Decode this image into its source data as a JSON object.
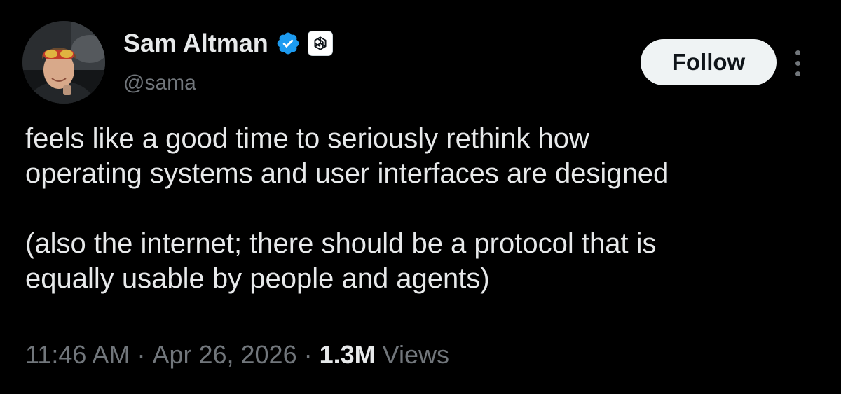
{
  "author": {
    "display_name": "Sam Altman",
    "handle": "@sama",
    "verified_icon": "verified-badge-icon",
    "affiliation_icon": "openai-logo-icon"
  },
  "actions": {
    "follow_label": "Follow",
    "more_icon": "more-vertical-icon"
  },
  "tweet": {
    "lines_paragraph_1": [
      "feels like a good time to seriously rethink how",
      "operating systems and user interfaces are designed"
    ],
    "lines_paragraph_2": [
      "(also the internet; there should be a protocol that is",
      "equally usable by people and agents)"
    ]
  },
  "meta": {
    "time": "11:46 AM",
    "separator": "·",
    "date": "Apr 26, 2026",
    "views_count": "1.3M",
    "views_label": "Views"
  },
  "colors": {
    "background": "#000000",
    "primary_text": "#e7e9ea",
    "secondary_text": "#71767b",
    "verified_blue": "#1d9bf0",
    "button_bg": "#eff3f4"
  }
}
